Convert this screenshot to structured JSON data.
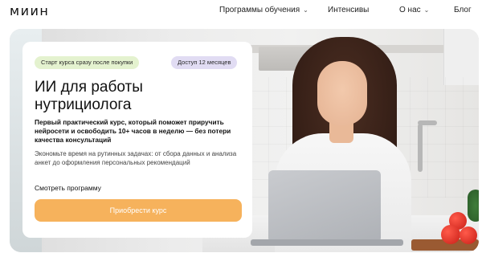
{
  "header": {
    "logo": "миин",
    "nav": [
      {
        "label": "Программы обучения",
        "has_dropdown": true
      },
      {
        "label": "Интенсивы",
        "has_dropdown": false
      },
      {
        "label": "О нас",
        "has_dropdown": true
      },
      {
        "label": "Блог",
        "has_dropdown": false
      }
    ]
  },
  "hero": {
    "badges": [
      {
        "label": "Старт курса  сразу после покупки"
      },
      {
        "label": "Доступ 12 месяцев"
      }
    ],
    "title": "ИИ для работы нутрициолога",
    "lead": "Первый практический курс, который поможет приручить нейросети и освободить 10+ часов в неделю — без потери качества консультаций",
    "description": "Экономьте время на рутинных задачах: от сбора данных и анализа анкет до оформления персональных рекомендаций",
    "program_link": "Смотреть программу",
    "cta": "Приобрести курс"
  },
  "colors": {
    "badge_start_bg": "#e4f2cf",
    "badge_access_bg": "#e1dcf3",
    "cta_bg": "#f6b25c",
    "cta_text": "#ffffff"
  }
}
